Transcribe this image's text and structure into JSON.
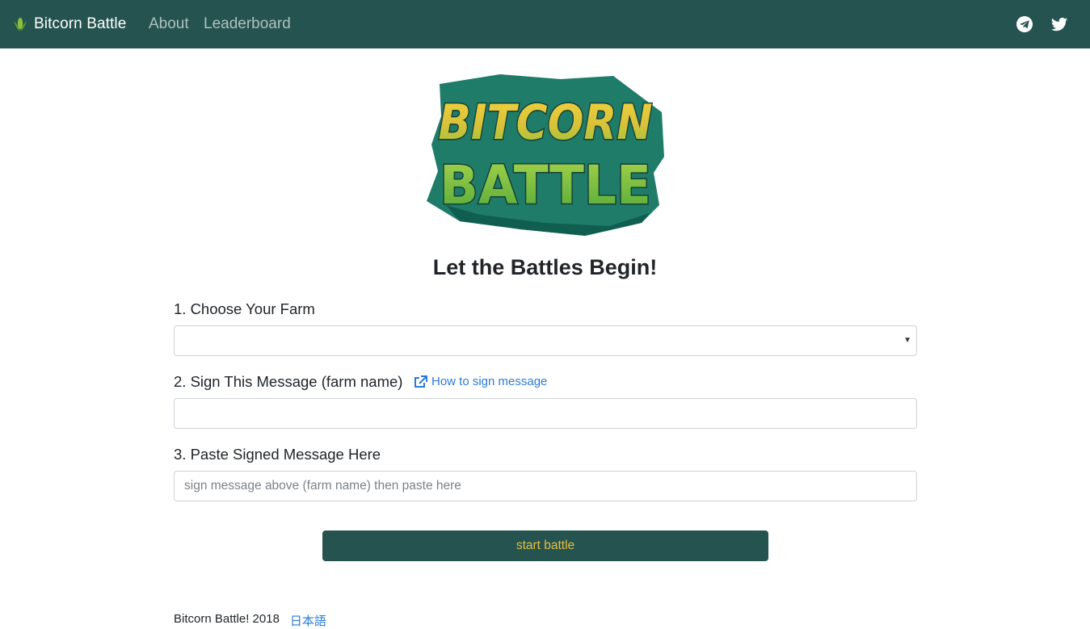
{
  "navbar": {
    "brand": "Bitcorn Battle",
    "links": [
      {
        "label": "About"
      },
      {
        "label": "Leaderboard"
      }
    ],
    "social": [
      "telegram-icon",
      "twitter-icon"
    ]
  },
  "logo": {
    "line1": "BITCORN",
    "line2": "BATTLE"
  },
  "page": {
    "title": "Let the Battles Begin!"
  },
  "form": {
    "step1_label": "1. Choose Your Farm",
    "farm_select_value": "",
    "step2_label": "2. Sign This Message (farm name)",
    "help_link": "How to sign message",
    "sign_message_value": "",
    "step3_label": "3. Paste Signed Message Here",
    "paste_placeholder": "sign message above (farm name) then paste here",
    "submit_label": "start battle"
  },
  "footer": {
    "copyright": "Bitcorn Battle! 2018",
    "language_link": "日本語"
  },
  "colors": {
    "navbar_bg": "#245350",
    "button_text": "#e7bf3c",
    "link": "#2a7bd8"
  }
}
